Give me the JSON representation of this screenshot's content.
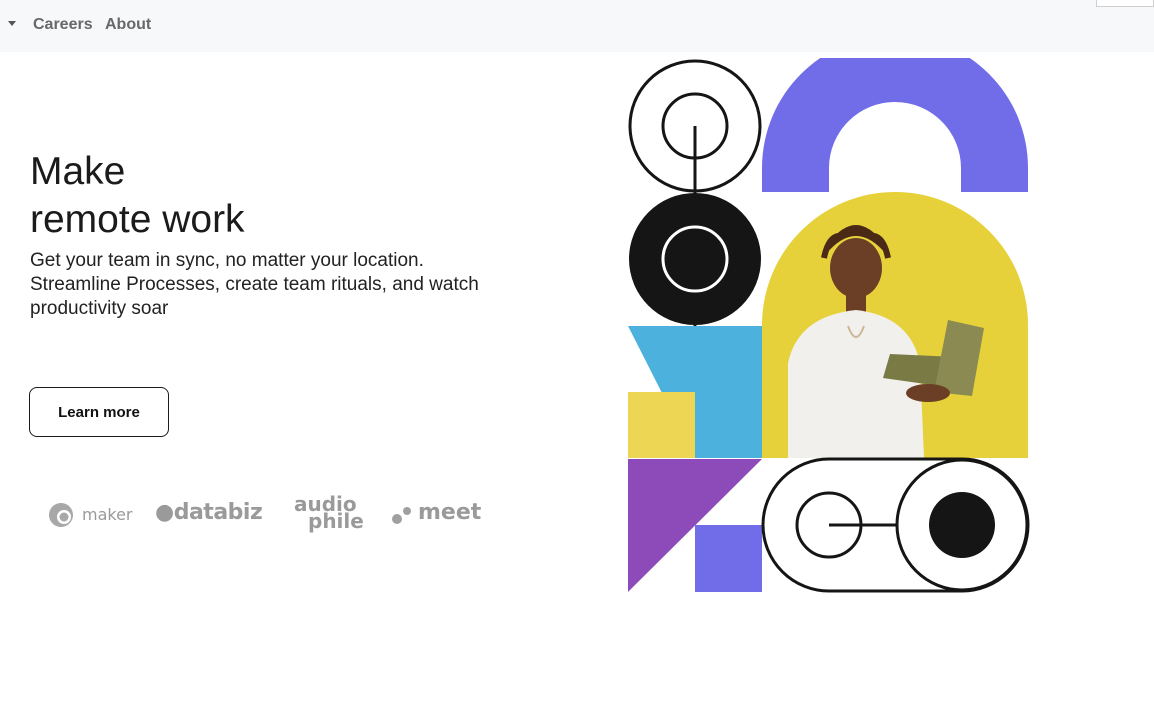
{
  "nav": {
    "links": [
      {
        "label": "Careers"
      },
      {
        "label": "About"
      }
    ]
  },
  "hero": {
    "title_line1": "Make",
    "title_line2": "remote work",
    "subtitle": "Get your team in sync, no matter your location. Streamline Processes, create team rituals, and watch productivity soar",
    "cta_label": "Learn more"
  },
  "clients": {
    "maker": "maker",
    "databiz": "databiz",
    "audiophile_line1": "audio",
    "audiophile_line2": "phile",
    "meet": "meet"
  },
  "colors": {
    "purple_blue": "#716de8",
    "yellow": "#e8d33b",
    "sky_blue": "#4cb1dc",
    "violet": "#8c4bb8",
    "mustard": "#ecd654",
    "ink": "#151515",
    "muted_logo": "#9a9a9a",
    "nav_bg": "#f7f8fa"
  }
}
